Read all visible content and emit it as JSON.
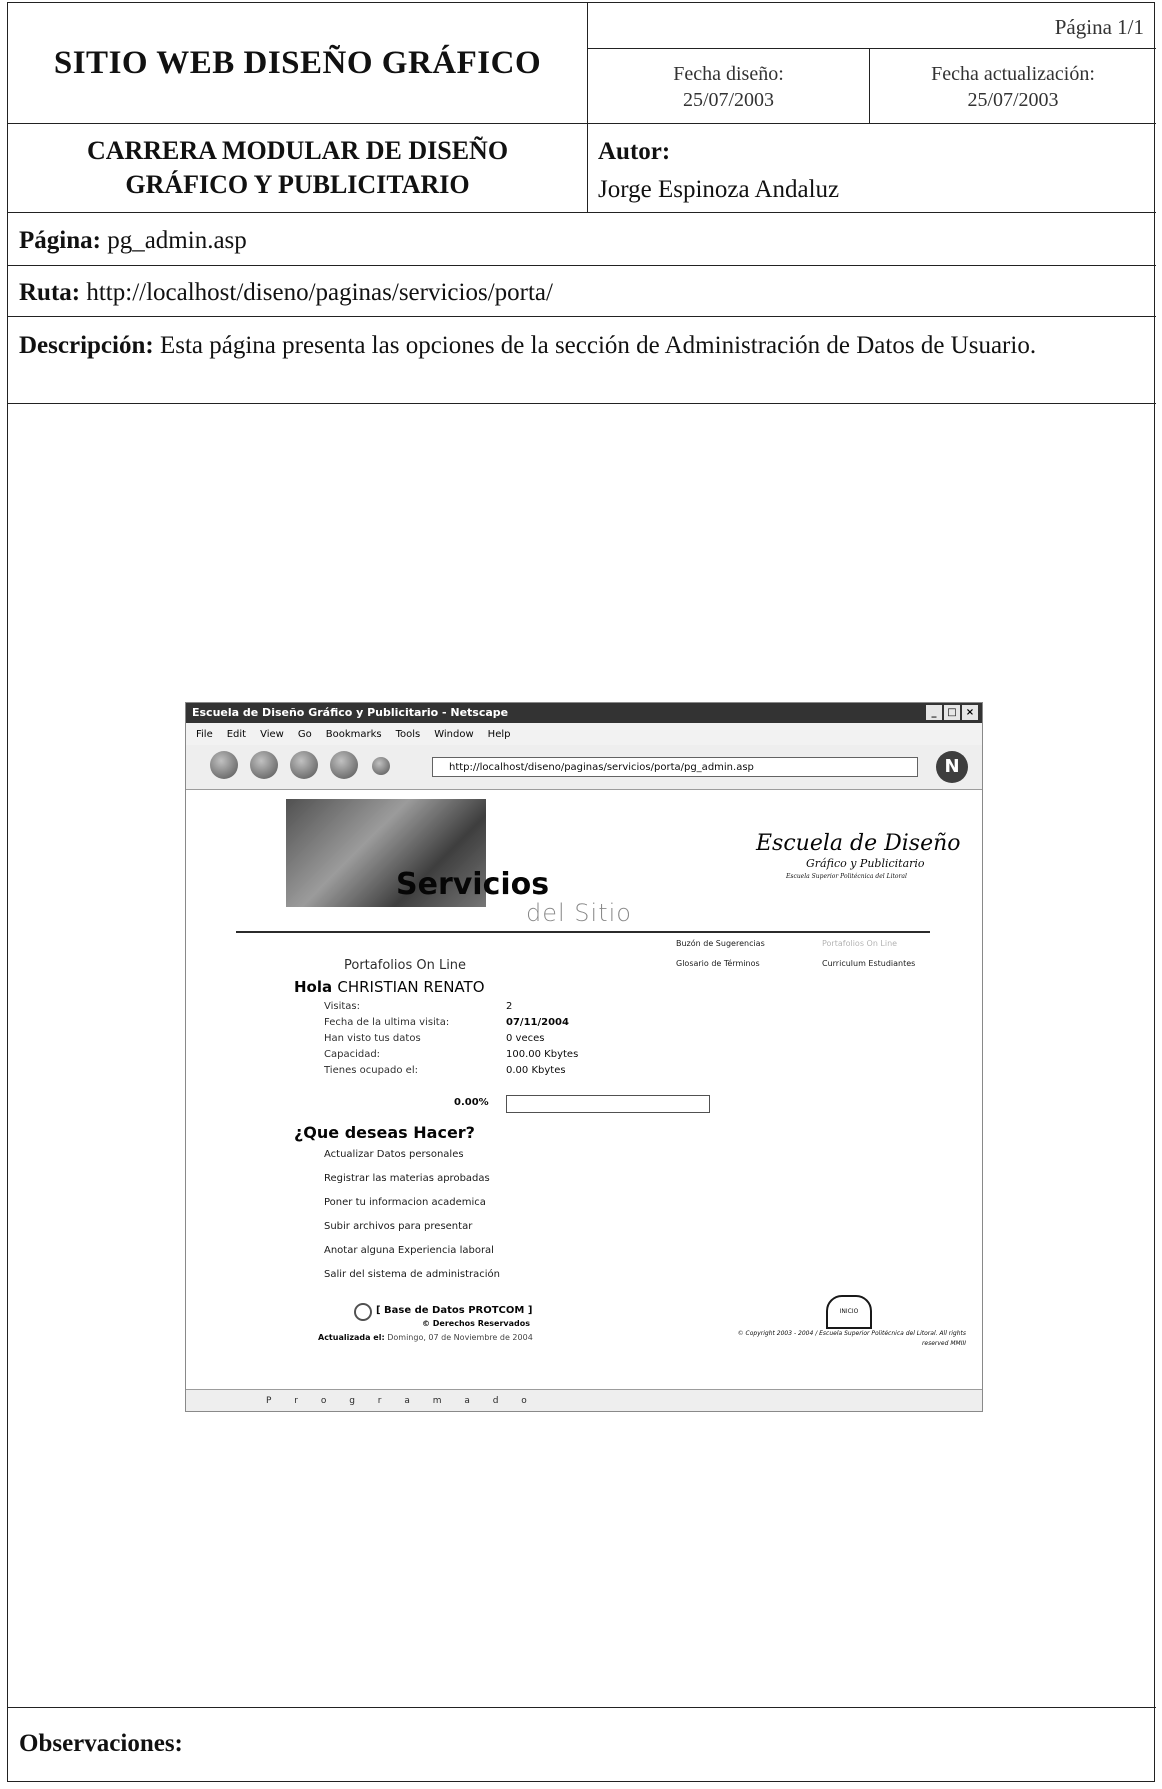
{
  "header": {
    "site_title": "SITIO WEB DISEÑO GRÁFICO",
    "page_number": "Página 1/1",
    "design_date_label": "Fecha diseño:",
    "design_date": "25/07/2003",
    "update_date_label": "Fecha actualización:",
    "update_date": "25/07/2003",
    "career_line1": "CARRERA MODULAR DE DISEÑO",
    "career_line2": "GRÁFICO Y PUBLICITARIO",
    "author_label": "Autor:",
    "author": "Jorge Espinoza Andaluz"
  },
  "fields": {
    "page_label": "Página:",
    "page_value": "pg_admin.asp",
    "route_label": "Ruta:",
    "route_value": "http://localhost/diseno/paginas/servicios/porta/",
    "description_label": "Descripción:",
    "description_value": "Esta página presenta las opciones de la sección de Administración de Datos de Usuario.",
    "observations_label": "Observaciones:"
  },
  "screenshot": {
    "window_title": "Escuela de Diseño Gráfico y Publicitario - Netscape",
    "menu": [
      "File",
      "Edit",
      "View",
      "Go",
      "Bookmarks",
      "Tools",
      "Window",
      "Help"
    ],
    "url": "http://localhost/diseno/paginas/servicios/porta/pg_admin.asp",
    "banner_title": "Servicios",
    "banner_subtitle": "del Sitio",
    "school_name": "Escuela de Diseño",
    "school_sub": "Gráfico y Publicitario",
    "school_sub2": "Escuela Superior Politécnica del Litoral",
    "nav_links": [
      "Buzón de Sugerencias",
      "Portafolios On Line",
      "Glosario de Términos",
      "Curriculum Estudiantes"
    ],
    "section_title": "Portafolios On Line",
    "greeting": "Hola",
    "user_name": "CHRISTIAN RENATO",
    "stats": [
      {
        "label": "Visitas:",
        "value": "2"
      },
      {
        "label": "Fecha de la ultima visita:",
        "value": "07/11/2004"
      },
      {
        "label": "Han visto tus datos",
        "value": "0 veces"
      },
      {
        "label": "Capacidad:",
        "value": "100.00 Kbytes"
      },
      {
        "label": "Tienes ocupado el:",
        "value": "0.00 Kbytes"
      }
    ],
    "usage_percent": "0.00%",
    "question": "¿Que deseas Hacer?",
    "options": [
      "Actualizar Datos personales",
      "Registrar las materias aprobadas",
      "Poner tu informacion academica",
      "Subir archivos para presentar",
      "Anotar alguna Experiencia laboral",
      "Salir del sistema de administración"
    ],
    "database": "[ Base de Datos PROTCOM ]",
    "rights": "© Derechos Reservados",
    "updated_label": "Actualizada el:",
    "updated_value": "Domingo, 07 de Noviembre de 2004",
    "home_label": "INICIO",
    "copyright": "© Copyright 2003 - 2004 / Escuela Superior Politécnica del Litoral. All rights reserved MMIII",
    "status_text": "P r o g r a m a d o"
  }
}
